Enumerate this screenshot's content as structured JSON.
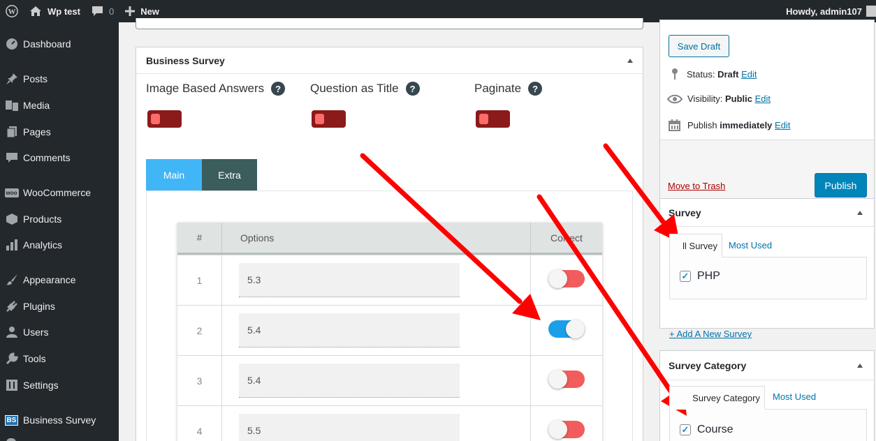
{
  "adminbar": {
    "site_name": "Wp test",
    "comments_count": "0",
    "new_label": "New",
    "greeting": "Howdy, admin107"
  },
  "sidebar": {
    "items": [
      {
        "label": "Dashboard",
        "icon": "dashboard-icon"
      },
      {
        "label": "Posts",
        "icon": "pin-icon"
      },
      {
        "label": "Media",
        "icon": "media-icon"
      },
      {
        "label": "Pages",
        "icon": "pages-icon"
      },
      {
        "label": "Comments",
        "icon": "comment-icon"
      },
      {
        "label": "WooCommerce",
        "icon": "woocommerce-icon",
        "icon_text": "woo"
      },
      {
        "label": "Products",
        "icon": "products-icon"
      },
      {
        "label": "Analytics",
        "icon": "analytics-icon"
      },
      {
        "label": "Appearance",
        "icon": "brush-icon"
      },
      {
        "label": "Plugins",
        "icon": "plugin-icon"
      },
      {
        "label": "Users",
        "icon": "users-icon"
      },
      {
        "label": "Tools",
        "icon": "wrench-icon"
      },
      {
        "label": "Settings",
        "icon": "settings-icon"
      },
      {
        "label": "Business Survey",
        "icon": "bs-icon",
        "icon_text": "BS"
      }
    ]
  },
  "survey_box": {
    "title": "Business Survey",
    "settings": [
      {
        "label": "Image Based Answers",
        "help": "?"
      },
      {
        "label": "Question as Title",
        "help": "?"
      },
      {
        "label": "Paginate",
        "help": "?"
      }
    ],
    "tabs": [
      "Main",
      "Extra"
    ],
    "table": {
      "headers": [
        "#",
        "Options",
        "Correct"
      ],
      "rows": [
        {
          "num": "1",
          "value": "5.3",
          "correct": false
        },
        {
          "num": "2",
          "value": "5.4",
          "correct": true
        },
        {
          "num": "3",
          "value": "5.4",
          "correct": false
        },
        {
          "num": "4",
          "value": "5.5",
          "correct": false
        }
      ]
    }
  },
  "publish_box": {
    "save_draft": "Save Draft",
    "status_label": "Status:",
    "status_value": "Draft",
    "visibility_label": "Visibility:",
    "visibility_value": "Public",
    "publish_label": "Publish",
    "publish_value": "immediately",
    "edit": "Edit",
    "trash": "Move to Trash",
    "publish_button": "Publish"
  },
  "survey_tax": {
    "title": "Survey",
    "tab_all": "All Survey",
    "tab_visible": "ll Survey",
    "tab_used": "Most Used",
    "term": "PHP",
    "checked": true,
    "add_new": "+ Add A New Survey"
  },
  "category_tax": {
    "title": "Survey Category",
    "tab_visible": "Survey Category",
    "tab_used": "Most Used",
    "term": "Course",
    "checked": true
  },
  "colors": {
    "wp_blue": "#0085ba",
    "main_tab": "#41b6f6",
    "extra_tab": "#3b5d5c",
    "annotation_arrow": "#ff0000",
    "toggle_on": "#1a9fe8",
    "toggle_off": "#f25c5c"
  }
}
